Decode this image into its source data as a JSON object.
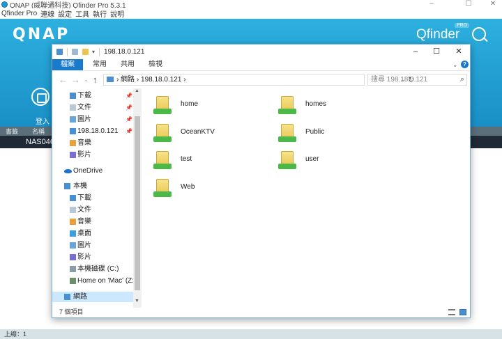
{
  "qfinder": {
    "window_title": "QNAP (威聯通科技) Qfinder Pro 5.3.1",
    "menu": [
      "Qfinder Pro",
      "連線",
      "設定",
      "工具",
      "執行",
      "說明"
    ],
    "logo": "QNAP",
    "app_name": "Qfinder",
    "pro_badge": "PRO",
    "login_label": "登入",
    "table_headers": [
      "書籤",
      "名稱"
    ],
    "table_row_name": "NAS0460",
    "status": "上線：1",
    "brand_color": "#1a8fc7"
  },
  "explorer": {
    "title": "198.18.0.121",
    "ribbon_tabs": [
      "檔案",
      "常用",
      "共用",
      "檢視"
    ],
    "address": {
      "segments": [
        "網路",
        "198.18.0.121"
      ],
      "separator": "›"
    },
    "search_placeholder": "搜尋 198.18.0.121",
    "nav_pane": [
      {
        "label": "下載",
        "icon": "download-folder-icon",
        "pinned": true
      },
      {
        "label": "文件",
        "icon": "documents-folder-icon",
        "pinned": true
      },
      {
        "label": "圖片",
        "icon": "pictures-folder-icon",
        "pinned": true
      },
      {
        "label": "198.18.0.121",
        "icon": "network-computer-icon",
        "pinned": true
      },
      {
        "label": "音樂",
        "icon": "music-folder-icon",
        "pinned": false
      },
      {
        "label": "影片",
        "icon": "videos-folder-icon",
        "pinned": false
      },
      {
        "label": "OneDrive",
        "icon": "onedrive-icon",
        "pinned": false
      },
      {
        "label": "本機",
        "icon": "this-pc-icon",
        "pinned": false
      },
      {
        "label": "下載",
        "icon": "download-folder-icon",
        "pinned": false
      },
      {
        "label": "文件",
        "icon": "documents-folder-icon",
        "pinned": false
      },
      {
        "label": "音樂",
        "icon": "music-folder-icon",
        "pinned": false
      },
      {
        "label": "桌面",
        "icon": "desktop-folder-icon",
        "pinned": false
      },
      {
        "label": "圖片",
        "icon": "pictures-folder-icon",
        "pinned": false
      },
      {
        "label": "影片",
        "icon": "videos-folder-icon",
        "pinned": false
      },
      {
        "label": "本機磁碟 (C:)",
        "icon": "local-disk-icon",
        "pinned": false
      },
      {
        "label": "Home on 'Mac' (Z:)",
        "icon": "network-drive-icon",
        "pinned": false
      },
      {
        "label": "網路",
        "icon": "network-icon",
        "pinned": false
      }
    ],
    "shares": [
      "home",
      "homes",
      "OceanKTV",
      "Public",
      "test",
      "user",
      "Web"
    ],
    "item_count": "7 個項目",
    "accent_color": "#1979ca"
  }
}
